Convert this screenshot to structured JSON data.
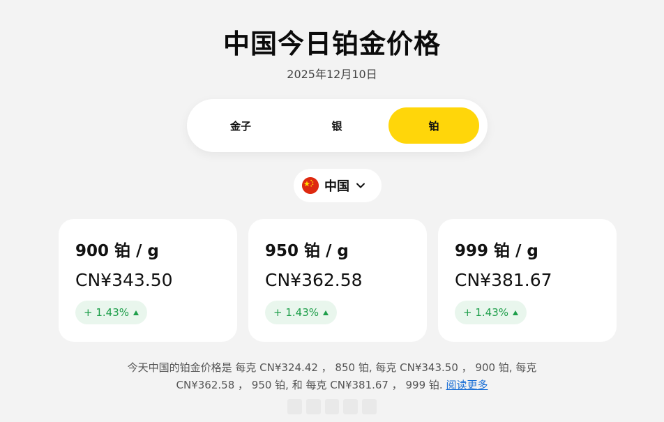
{
  "header": {
    "title": "中国今日铂金价格",
    "date": "2025年12月10日"
  },
  "tabs": [
    {
      "label": "金子",
      "active": false
    },
    {
      "label": "银",
      "active": false
    },
    {
      "label": "铂",
      "active": true
    }
  ],
  "country_selector": {
    "name": "中国",
    "flag_icon": "china-flag-icon",
    "chevron_icon": "chevron-down-icon"
  },
  "cards": [
    {
      "title": "900 铂 / g",
      "price": "CN¥343.50",
      "change": "+ 1.43%"
    },
    {
      "title": "950 铂 / g",
      "price": "CN¥362.58",
      "change": "+ 1.43%"
    },
    {
      "title": "999 铂 / g",
      "price": "CN¥381.67",
      "change": "+ 1.43%"
    }
  ],
  "summary": {
    "text": "今天中国的铂金价格是 每克 CN¥324.42 ， 850 铂, 每克 CN¥343.50 ， 900 铂, 每克 CN¥362.58 ， 950 铂, 和 每克 CN¥381.67 ， 999 铂.",
    "read_more": "阅读更多"
  },
  "colors": {
    "accent": "#ffd60a",
    "positive": "#1e9e4a",
    "background": "#f3f3f3"
  }
}
